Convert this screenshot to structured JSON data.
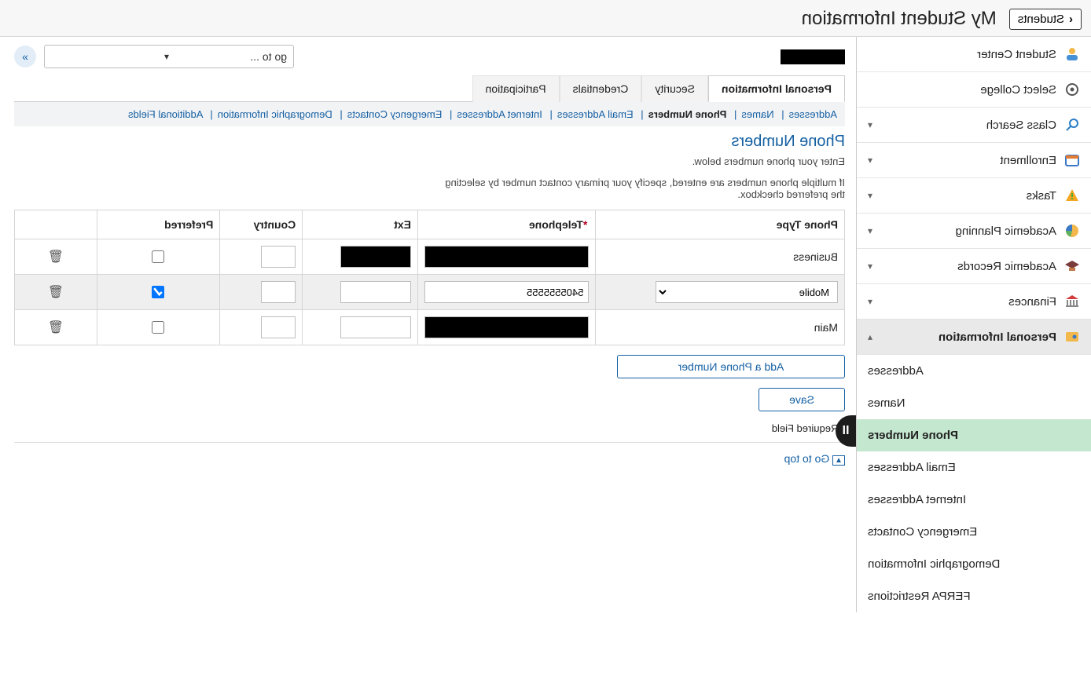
{
  "header": {
    "back_button_label": "Students",
    "page_title": "My Student Information"
  },
  "sidebar": {
    "items": [
      {
        "label": "Student Center",
        "icon": "person"
      },
      {
        "label": "Select College",
        "icon": "gear"
      },
      {
        "label": "Class Search",
        "icon": "search",
        "expandable": true
      },
      {
        "label": "Enrollment",
        "icon": "calendar",
        "expandable": true
      },
      {
        "label": "Tasks",
        "icon": "warning",
        "expandable": true
      },
      {
        "label": "Academic Planning",
        "icon": "pie",
        "expandable": true
      },
      {
        "label": "Academic Records",
        "icon": "grad",
        "expandable": true
      },
      {
        "label": "Finances",
        "icon": "bank",
        "expandable": true
      },
      {
        "label": "Personal Information",
        "icon": "id",
        "expandable": true,
        "expanded": true
      }
    ],
    "personal_information_subitems": [
      {
        "label": "Addresses"
      },
      {
        "label": "Names"
      },
      {
        "label": "Phone Numbers",
        "current": true
      },
      {
        "label": "Email Addresses"
      },
      {
        "label": "Internet Addresses"
      },
      {
        "label": "Emergency Contacts"
      },
      {
        "label": "Demographic Information"
      },
      {
        "label": "FERPA Restrictions"
      }
    ]
  },
  "student_bar": {
    "go_to_label": "go to ...",
    "go_button_tooltip": "Go"
  },
  "tabs": [
    {
      "label": "Personal Information",
      "active": true
    },
    {
      "label": "Security"
    },
    {
      "label": "Credentials"
    },
    {
      "label": "Participation"
    }
  ],
  "breadcrumbs": [
    {
      "label": "Addresses"
    },
    {
      "label": "Names"
    },
    {
      "label": "Phone Numbers",
      "current": true
    },
    {
      "label": "Email Addresses"
    },
    {
      "label": "Internet Addresses"
    },
    {
      "label": "Emergency Contacts"
    },
    {
      "label": "Demographic Information"
    },
    {
      "label": "Additional Fields"
    }
  ],
  "section": {
    "title": "Phone Numbers",
    "help_line1": "Enter your phone numbers below.",
    "help_line2": "If multiple phone numbers are entered, specify your primary contact number by selecting the preferred checkbox."
  },
  "table": {
    "headers": {
      "phone_type": "Phone Type",
      "telephone": "Telephone",
      "ext": "Ext",
      "country": "Country",
      "preferred": "Preferred"
    },
    "rows": [
      {
        "type_label": "Business",
        "telephone": "",
        "ext": "",
        "country": "",
        "preferred": false,
        "redacted": true,
        "editable_type": false
      },
      {
        "type_label": "Mobile",
        "telephone": "5405555555",
        "ext": "",
        "country": "",
        "preferred": true,
        "editable_type": true
      },
      {
        "type_label": "Main",
        "telephone": "",
        "ext": "",
        "country": "",
        "preferred": false,
        "redacted": true,
        "editable_type": false
      }
    ]
  },
  "actions": {
    "add_label": "Add a Phone Number",
    "save_label": "Save"
  },
  "footer": {
    "required_note": "* Required Field",
    "go_top_label": "Go to top"
  }
}
